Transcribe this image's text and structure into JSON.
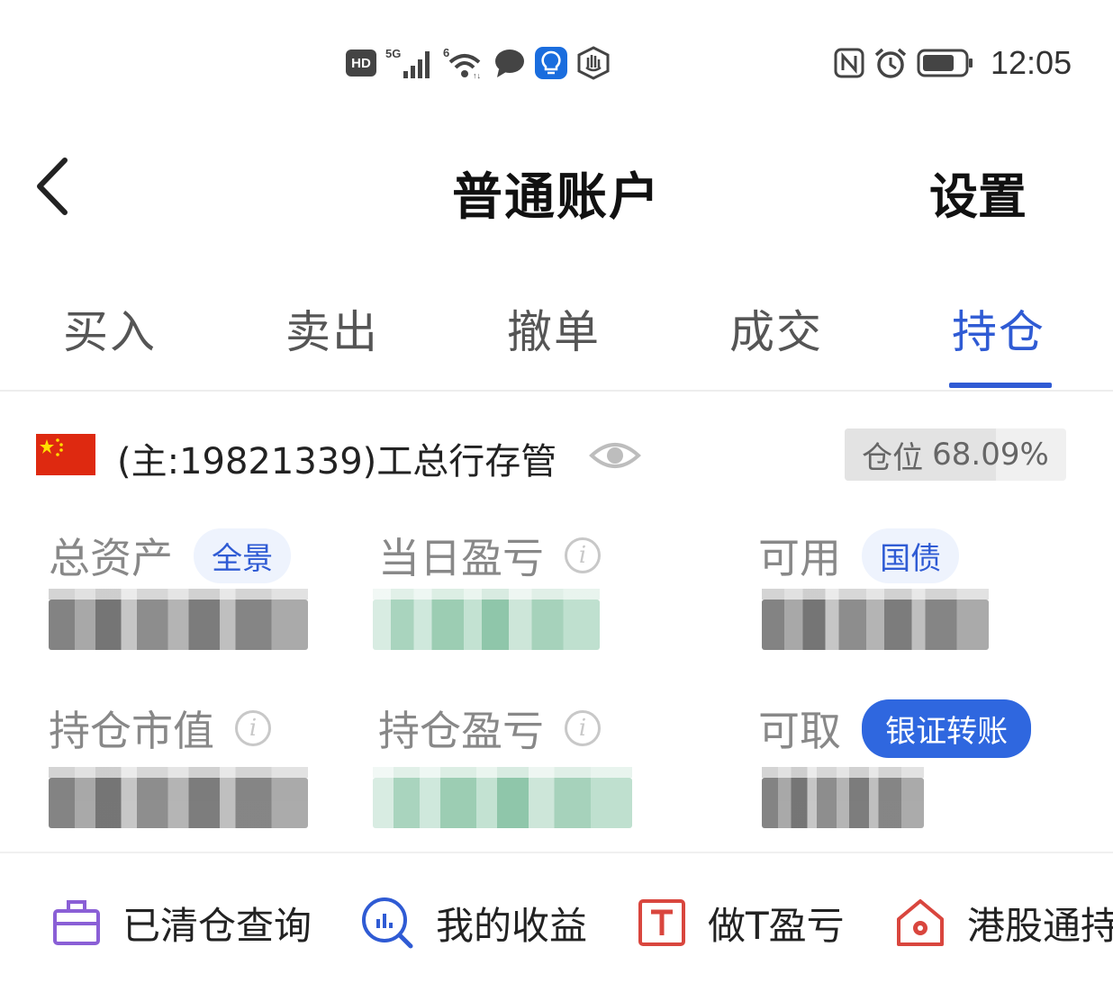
{
  "status_bar": {
    "time": "12:05",
    "hd_label": "HD",
    "network_label": "5G",
    "wifi_label": "6",
    "icons": [
      "hd-icon",
      "signal-5g-icon",
      "wifi-6-icon",
      "message-bubble-icon",
      "bulb-icon",
      "hand-shield-icon",
      "nfc-icon",
      "alarm-icon",
      "battery-icon"
    ]
  },
  "header": {
    "title": "普通账户",
    "settings_label": "设置",
    "back_icon": "chevron-left-icon"
  },
  "tabs": [
    {
      "label": "买入",
      "active": false
    },
    {
      "label": "卖出",
      "active": false
    },
    {
      "label": "撤单",
      "active": false
    },
    {
      "label": "成交",
      "active": false
    },
    {
      "label": "持仓",
      "active": true
    }
  ],
  "account": {
    "flag_icon": "china-flag-icon",
    "name": "(主:19821339)工总行存管",
    "visibility_icon": "eye-icon",
    "position_label": "仓位",
    "position_value": "68.09%",
    "position_fraction": 0.6809
  },
  "metrics": {
    "total_assets": {
      "label": "总资产",
      "pill": "全景"
    },
    "daily_pnl": {
      "label": "当日盈亏",
      "info_icon": "info-icon"
    },
    "available": {
      "label": "可用",
      "pill": "国债"
    },
    "market_value": {
      "label": "持仓市值",
      "info_icon": "info-icon"
    },
    "holding_pnl": {
      "label": "持仓盈亏",
      "info_icon": "info-icon"
    },
    "withdrawable": {
      "label": "可取",
      "pill": "银证转账"
    }
  },
  "shortcuts": [
    {
      "label": "已清仓查询",
      "icon": "briefcase-icon"
    },
    {
      "label": "我的收益",
      "icon": "magnifier-chart-icon"
    },
    {
      "label": "做T盈亏",
      "icon": "t-box-icon"
    },
    {
      "label": "港股通持",
      "icon": "hk-house-icon"
    }
  ],
  "colors": {
    "accent": "#2f5bd4",
    "pill_bg": "#eef3fd",
    "text_primary": "#1f1f1f",
    "text_secondary": "#888888"
  }
}
